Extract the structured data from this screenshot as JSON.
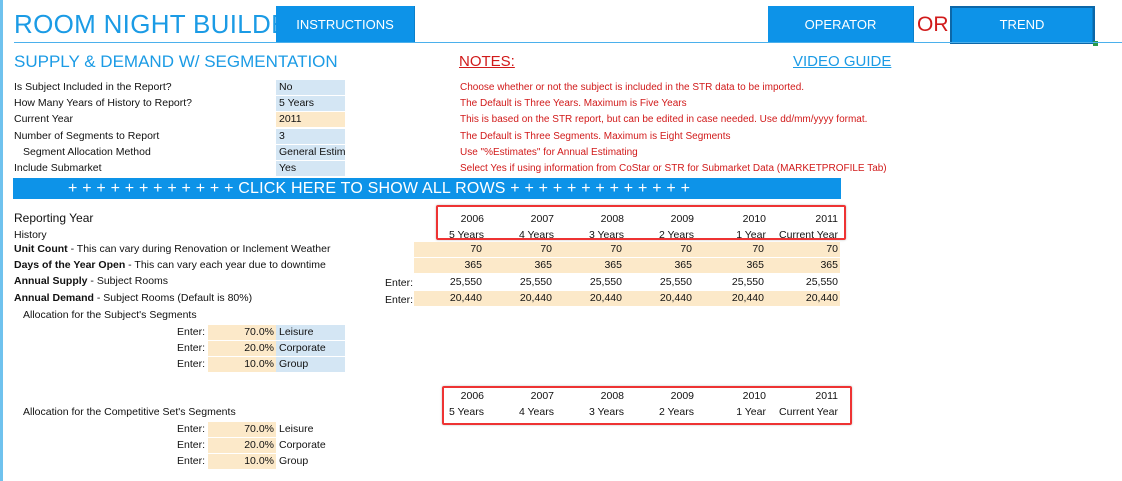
{
  "header": {
    "title": "ROOM NIGHT BUILDER",
    "instructions_label": "INSTRUCTIONS",
    "operator_label": "OPERATOR",
    "or_label": "OR",
    "trend_label": "TREND"
  },
  "section_title": "SUPPLY & DEMAND W/ SEGMENTATION",
  "notes_title": "NOTES:",
  "video_guide": "VIDEO GUIDE",
  "settings": [
    {
      "label": "Is Subject Included in the Report?",
      "value": "No",
      "note": "Choose whether or not the subject is included in the STR data to be imported."
    },
    {
      "label": "How Many Years of History to Report?",
      "value": "5 Years",
      "note": "The Default is Three Years. Maximum is Five Years"
    },
    {
      "label": "Current Year",
      "value": "2011",
      "note": "This is based on the STR report, but can be edited in case needed. Use dd/mm/yyyy format."
    },
    {
      "label": "Number of Segments to Report",
      "value": "3",
      "note": "The Default is Three Segments. Maximum is Eight Segments"
    },
    {
      "label": "Segment Allocation Method",
      "value": "General Estimates",
      "note": "Use \"%Estimates\" for Annual Estimating"
    },
    {
      "label": "Include Submarket",
      "value": "Yes",
      "note": "Select Yes if using information from CoStar or STR for Submarket Data (MARKETPROFILE Tab)"
    }
  ],
  "banner": "+ + + + + + + + + + + + CLICK HERE TO SHOW ALL ROWS + + + + + + + + + + + + +",
  "reporting": {
    "title": "Reporting Year",
    "history_label": "History",
    "years": [
      "2006",
      "2007",
      "2008",
      "2009",
      "2010",
      "2011"
    ],
    "history": [
      "5 Years",
      "4 Years",
      "3 Years",
      "2 Years",
      "1 Year",
      "Current Year"
    ]
  },
  "rows": {
    "unit_count": {
      "bold": "Unit Count",
      "rest": " - This can vary during Renovation or Inclement Weather",
      "values": [
        "70",
        "70",
        "70",
        "70",
        "70",
        "70"
      ]
    },
    "days_open": {
      "bold": "Days of the Year Open",
      "rest": " - This can vary each year due to downtime",
      "values": [
        "365",
        "365",
        "365",
        "365",
        "365",
        "365"
      ]
    },
    "annual_supply": {
      "bold": "Annual Supply",
      "rest": "  - Subject Rooms",
      "enter": "Enter:",
      "values": [
        "25,550",
        "25,550",
        "25,550",
        "25,550",
        "25,550",
        "25,550"
      ]
    },
    "annual_demand": {
      "bold": "Annual Demand",
      "rest": " - Subject Rooms (Default is 80%)",
      "enter": "Enter:",
      "values": [
        "20,440",
        "20,440",
        "20,440",
        "20,440",
        "20,440",
        "20,440"
      ]
    }
  },
  "subject_alloc": {
    "title": "Allocation for the Subject's Segments",
    "rows": [
      {
        "enter": "Enter:",
        "pct": "70.0%",
        "name": "Leisure"
      },
      {
        "enter": "Enter:",
        "pct": "20.0%",
        "name": "Corporate"
      },
      {
        "enter": "Enter:",
        "pct": "10.0%",
        "name": "Group"
      }
    ]
  },
  "comp_alloc": {
    "title": "Allocation for the Competitive Set's Segments",
    "years": [
      "2006",
      "2007",
      "2008",
      "2009",
      "2010",
      "2011"
    ],
    "history": [
      "5 Years",
      "4 Years",
      "3 Years",
      "2 Years",
      "1 Year",
      "Current Year"
    ],
    "rows": [
      {
        "enter": "Enter:",
        "pct": "70.0%",
        "name": "Leisure"
      },
      {
        "enter": "Enter:",
        "pct": "20.0%",
        "name": "Corporate"
      },
      {
        "enter": "Enter:",
        "pct": "10.0%",
        "name": "Group"
      }
    ]
  },
  "colors": {
    "accent": "#0d93e8",
    "title": "#1b9be5",
    "note": "#d11a1a",
    "input_blue": "#d4e6f4",
    "input_tan": "#fce9c9",
    "highlight": "#e33333"
  }
}
